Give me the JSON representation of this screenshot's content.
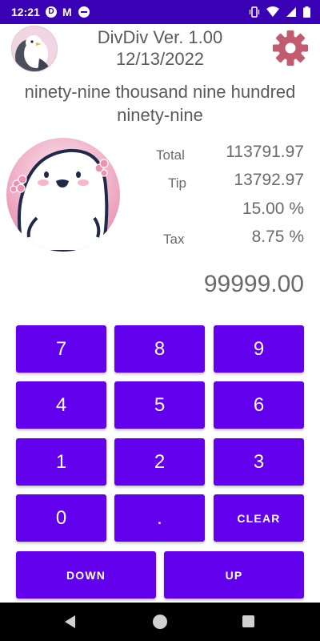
{
  "status_bar": {
    "time": "12:21",
    "notif_icon_char": "D",
    "mail_icon_char": "M"
  },
  "header": {
    "title": "DivDiv Ver. 1.00",
    "date": "12/13/2022"
  },
  "amount_words": "ninety-nine thousand nine hundred ninety-nine",
  "summary": {
    "total_label": "Total",
    "total_value": "113791.97",
    "tip_label": "Tip",
    "tip_value": "13792.97",
    "tip_percent": "15.00 %",
    "tax_label": "Tax",
    "tax_percent": "8.75 %"
  },
  "entry_value": "99999.00",
  "keypad": {
    "k7": "7",
    "k8": "8",
    "k9": "9",
    "k4": "4",
    "k5": "5",
    "k6": "6",
    "k1": "1",
    "k2": "2",
    "k3": "3",
    "k0": "0",
    "kdot": ".",
    "clear": "CLEAR",
    "down": "DOWN",
    "up": "UP"
  },
  "colors": {
    "status_bar": "#3a00b3",
    "button": "#6200ee",
    "settings_gear": "#c25b6e",
    "nav_bar": "#000000"
  },
  "icons": {
    "settings": "gear-icon",
    "avatar": "bird-avatar-icon",
    "nav_back": "back-triangle-icon",
    "nav_home": "home-circle-icon",
    "nav_recent": "recent-square-icon"
  }
}
